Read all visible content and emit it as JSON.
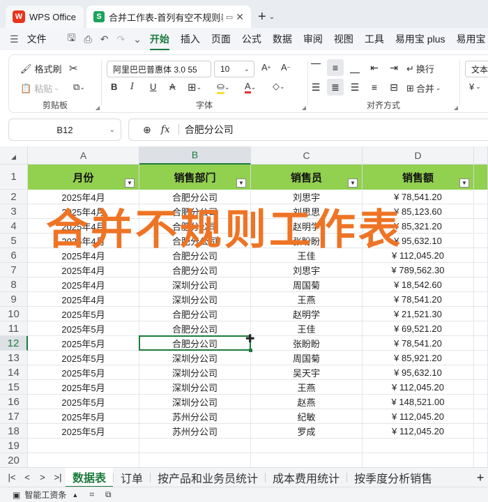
{
  "titlebar": {
    "home_tab": "WPS Office",
    "doc_tab": "合并工作表-首列有空不规则表",
    "new_tab_icon": "plus-icon"
  },
  "menu": {
    "file": "文件",
    "items": [
      "开始",
      "插入",
      "页面",
      "公式",
      "数据",
      "审阅",
      "视图",
      "工具",
      "易用宝 plus",
      "易用宝"
    ]
  },
  "ribbon": {
    "clipboard": {
      "format_painter": "格式刷",
      "paste": "粘贴",
      "group_name": "剪贴板"
    },
    "font": {
      "font_name": "阿里巴巴普惠体 3.0 55",
      "font_size": "10",
      "group_name": "字体"
    },
    "alignment": {
      "wrap": "换行",
      "merge": "合并",
      "group_name": "对齐方式"
    },
    "number": {
      "format": "文本",
      "currency_symbol": "¥"
    }
  },
  "formula_bar": {
    "cell_ref": "B12",
    "fx": "fx",
    "content": "合肥分公司"
  },
  "grid": {
    "columns": [
      "A",
      "B",
      "C",
      "D"
    ],
    "headers": [
      "月份",
      "销售部门",
      "销售员",
      "销售额"
    ],
    "row_numbers": [
      "1",
      "2",
      "3",
      "4",
      "5",
      "6",
      "7",
      "8",
      "9",
      "10",
      "11",
      "12",
      "13",
      "14",
      "15",
      "16",
      "17",
      "18",
      "19",
      "20"
    ],
    "rows": [
      [
        "2025年4月",
        "合肥分公司",
        "刘思宇",
        "¥ 78,541.20"
      ],
      [
        "2025年4月",
        "合肥分公司",
        "刘思思",
        "¥ 85,123.60"
      ],
      [
        "2025年4月",
        "合肥分公司",
        "赵明学",
        "¥ 85,321.20"
      ],
      [
        "2025年4月",
        "合肥分公司",
        "张盼盼",
        "¥ 95,632.10"
      ],
      [
        "2025年4月",
        "合肥分公司",
        "王佳",
        "¥ 112,045.20"
      ],
      [
        "2025年4月",
        "合肥分公司",
        "刘思宇",
        "¥ 789,562.30"
      ],
      [
        "2025年4月",
        "深圳分公司",
        "周国菊",
        "¥ 18,542.60"
      ],
      [
        "2025年4月",
        "深圳分公司",
        "王燕",
        "¥ 78,541.20"
      ],
      [
        "2025年5月",
        "合肥分公司",
        "赵明学",
        "¥ 21,521.30"
      ],
      [
        "2025年5月",
        "合肥分公司",
        "王佳",
        "¥ 69,521.20"
      ],
      [
        "2025年5月",
        "合肥分公司",
        "张盼盼",
        "¥ 78,541.20"
      ],
      [
        "2025年5月",
        "深圳分公司",
        "周国菊",
        "¥ 85,921.20"
      ],
      [
        "2025年5月",
        "深圳分公司",
        "吴天宇",
        "¥ 95,632.10"
      ],
      [
        "2025年5月",
        "深圳分公司",
        "王燕",
        "¥ 112,045.20"
      ],
      [
        "2025年5月",
        "深圳分公司",
        "赵燕",
        "¥ 148,521.00"
      ],
      [
        "2025年5月",
        "苏州分公司",
        "纪敏",
        "¥ 112,045.20"
      ],
      [
        "2025年5月",
        "苏州分公司",
        "罗成",
        "¥ 112,045.20"
      ]
    ],
    "selected_cell": "B12",
    "header_color": "#92d050"
  },
  "overlay_text": "合并不规则工作表",
  "sheet_tabs": [
    "数据表",
    "订单",
    "按产品和业务员统计",
    "成本费用统计",
    "按季度分析销售"
  ],
  "status": {
    "label": "智能工资条"
  },
  "colors": {
    "accent": "#1b7a3c",
    "overlay": "#ee7425"
  }
}
